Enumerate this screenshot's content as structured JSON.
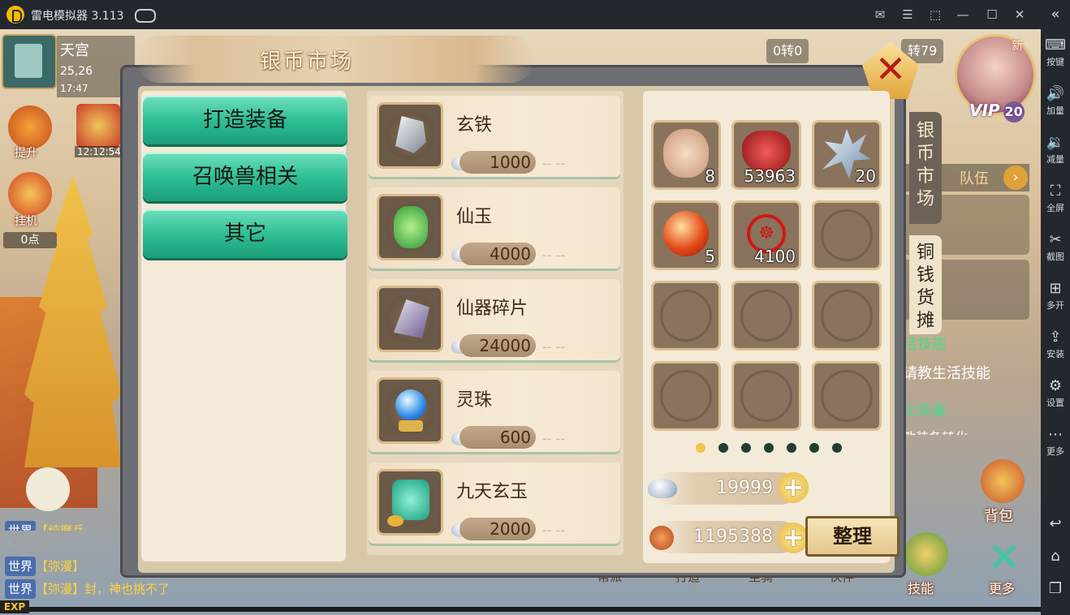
{
  "emulator": {
    "title": "雷电模拟器 3.113",
    "sidebar": [
      {
        "label": "按键",
        "icon": "keyboard-icon"
      },
      {
        "label": "加量",
        "icon": "volume-up-icon"
      },
      {
        "label": "减量",
        "icon": "volume-down-icon"
      },
      {
        "label": "全屏",
        "icon": "fullscreen-icon"
      },
      {
        "label": "截图",
        "icon": "scissors-icon"
      },
      {
        "label": "多开",
        "icon": "multi-instance-icon"
      },
      {
        "label": "安装",
        "icon": "apk-install-icon"
      },
      {
        "label": "设置",
        "icon": "gear-icon"
      },
      {
        "label": "更多",
        "icon": "more-icon"
      }
    ]
  },
  "hud": {
    "location_name": "天宫",
    "coords": "25,26",
    "time": "17:47",
    "btn_upgrade": "提升",
    "timer": "12:12:54",
    "btn_idle": "挂机",
    "points": "0点",
    "stat_left": "0转0",
    "stat_right": "转79",
    "vip_label": "VIP",
    "vip_level": "20",
    "new_badge": "新",
    "team_label": "队伍",
    "skill_green": "活技能",
    "skill_text": "请教生活技能",
    "equip_green": "比装备",
    "equip_text": "教装备转化",
    "bag_label": "背包",
    "skill_btn": "技能",
    "more_btn": "更多",
    "bottom_tabs": [
      "帮派",
      "打造",
      "坐骑",
      "伙伴"
    ],
    "exp_label": "EXP",
    "chat": [
      {
        "channel": "世界",
        "text": "【纯魔兵"
      },
      {
        "channel": "",
        "text": "?"
      },
      {
        "channel": "世界",
        "text": "【弥漫】"
      },
      {
        "channel": "世界",
        "text": "【弥漫】封，神也挑不了"
      }
    ]
  },
  "dialog": {
    "title": "银币市场",
    "categories": [
      "打造装备",
      "召唤兽相关",
      "其它"
    ],
    "items": [
      {
        "name": "玄铁",
        "price": "1000",
        "icon": "black-iron-ore-icon",
        "color": "#d8dde4"
      },
      {
        "name": "仙玉",
        "price": "4000",
        "icon": "jade-pendant-icon",
        "color": "#3fbf55"
      },
      {
        "name": "仙器碎片",
        "price": "24000",
        "icon": "crystal-shard-icon",
        "color": "#8a7aa8"
      },
      {
        "name": "灵珠",
        "price": "600",
        "icon": "crystal-ball-icon",
        "color": "#3a8fe8"
      },
      {
        "name": "九天玄玉",
        "price": "2000",
        "icon": "jade-tablet-icon",
        "color": "#36c8a0"
      }
    ],
    "price_suffix": "-- --",
    "inventory": [
      {
        "icon": "pig-doll-icon",
        "count": "8"
      },
      {
        "icon": "chocolate-box-icon",
        "count": "53963"
      },
      {
        "icon": "ice-coral-icon",
        "count": "20"
      },
      {
        "icon": "fire-orb-icon",
        "count": "5"
      },
      {
        "icon": "red-seal-icon",
        "count": "4100"
      },
      {
        "icon": "",
        "count": ""
      },
      {
        "icon": "",
        "count": ""
      },
      {
        "icon": "",
        "count": ""
      },
      {
        "icon": "",
        "count": ""
      },
      {
        "icon": "",
        "count": ""
      },
      {
        "icon": "",
        "count": ""
      },
      {
        "icon": "",
        "count": ""
      }
    ],
    "page_dots": {
      "total": 7,
      "current": 1
    },
    "silver_amount": "19999",
    "copper_amount": "1195388",
    "sort_button": "整理",
    "tab_silver": "银币市场",
    "tab_copper": "铜钱货摊"
  }
}
